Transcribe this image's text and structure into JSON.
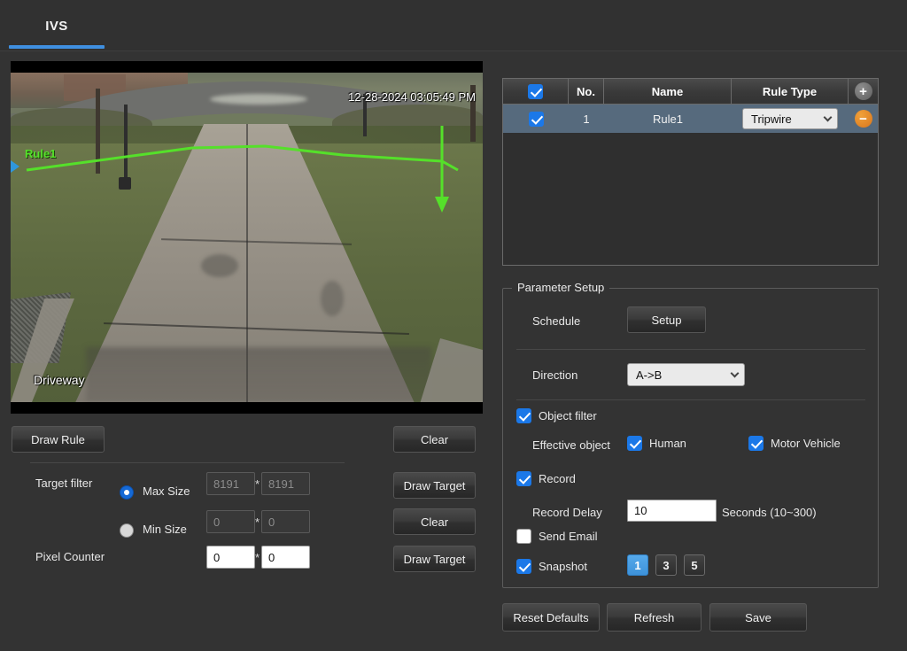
{
  "window": {
    "bg_color": "#333333",
    "accent_color": "#3f8ee0"
  },
  "tabs": [
    {
      "label": "IVS",
      "active": true
    }
  ],
  "video": {
    "timestamp": "12-28-2024 03:05:49 PM",
    "channel_name": "Driveway",
    "rule_label": "Rule1",
    "rule_line_color": "#55e02a",
    "direction_marker_color": "#2f97dd"
  },
  "left_panel": {
    "draw_rule_label": "Draw Rule",
    "clear_label_1": "Clear",
    "draw_target_label_1": "Draw Target",
    "clear_label_2": "Clear",
    "draw_target_label_2": "Draw Target",
    "target_filter_label": "Target filter",
    "max_size_label": "Max Size",
    "min_size_label": "Min Size",
    "pixel_counter_label": "Pixel Counter",
    "size_separator": "*",
    "max_size_width": "8191",
    "max_size_height": "8191",
    "min_size_width": "0",
    "min_size_height": "0",
    "pixel_counter_width": "0",
    "pixel_counter_height": "0",
    "size_mode_selected": "Max Size"
  },
  "rule_table": {
    "headers": {
      "select_all_checked": true,
      "no": "No.",
      "name": "Name",
      "rule_type": "Rule Type",
      "add_icon": "+"
    },
    "rows": [
      {
        "checked": true,
        "no": "1",
        "name": "Rule1",
        "rule_type": "Tripwire",
        "delete_icon": "−"
      }
    ],
    "selected_row_color": "#566a7d"
  },
  "parameter_setup": {
    "legend": "Parameter Setup",
    "schedule_label": "Schedule",
    "schedule_setup_label": "Setup",
    "direction_label": "Direction",
    "direction_value": "A->B",
    "object_filter_label": "Object filter",
    "object_filter_checked": true,
    "effective_object_label": "Effective object",
    "human_label": "Human",
    "human_checked": true,
    "motor_vehicle_label": "Motor Vehicle",
    "motor_vehicle_checked": true,
    "record_label": "Record",
    "record_checked": true,
    "record_delay_label": "Record Delay",
    "record_delay_value": "10",
    "record_delay_units": "Seconds (10~300)",
    "send_email_label": "Send Email",
    "send_email_checked": false,
    "snapshot_label": "Snapshot",
    "snapshot_checked": true,
    "snapshot_options": [
      "1",
      "3",
      "5"
    ],
    "snapshot_selected": "1"
  },
  "footer": {
    "reset_defaults_label": "Reset Defaults",
    "refresh_label": "Refresh",
    "save_label": "Save"
  }
}
